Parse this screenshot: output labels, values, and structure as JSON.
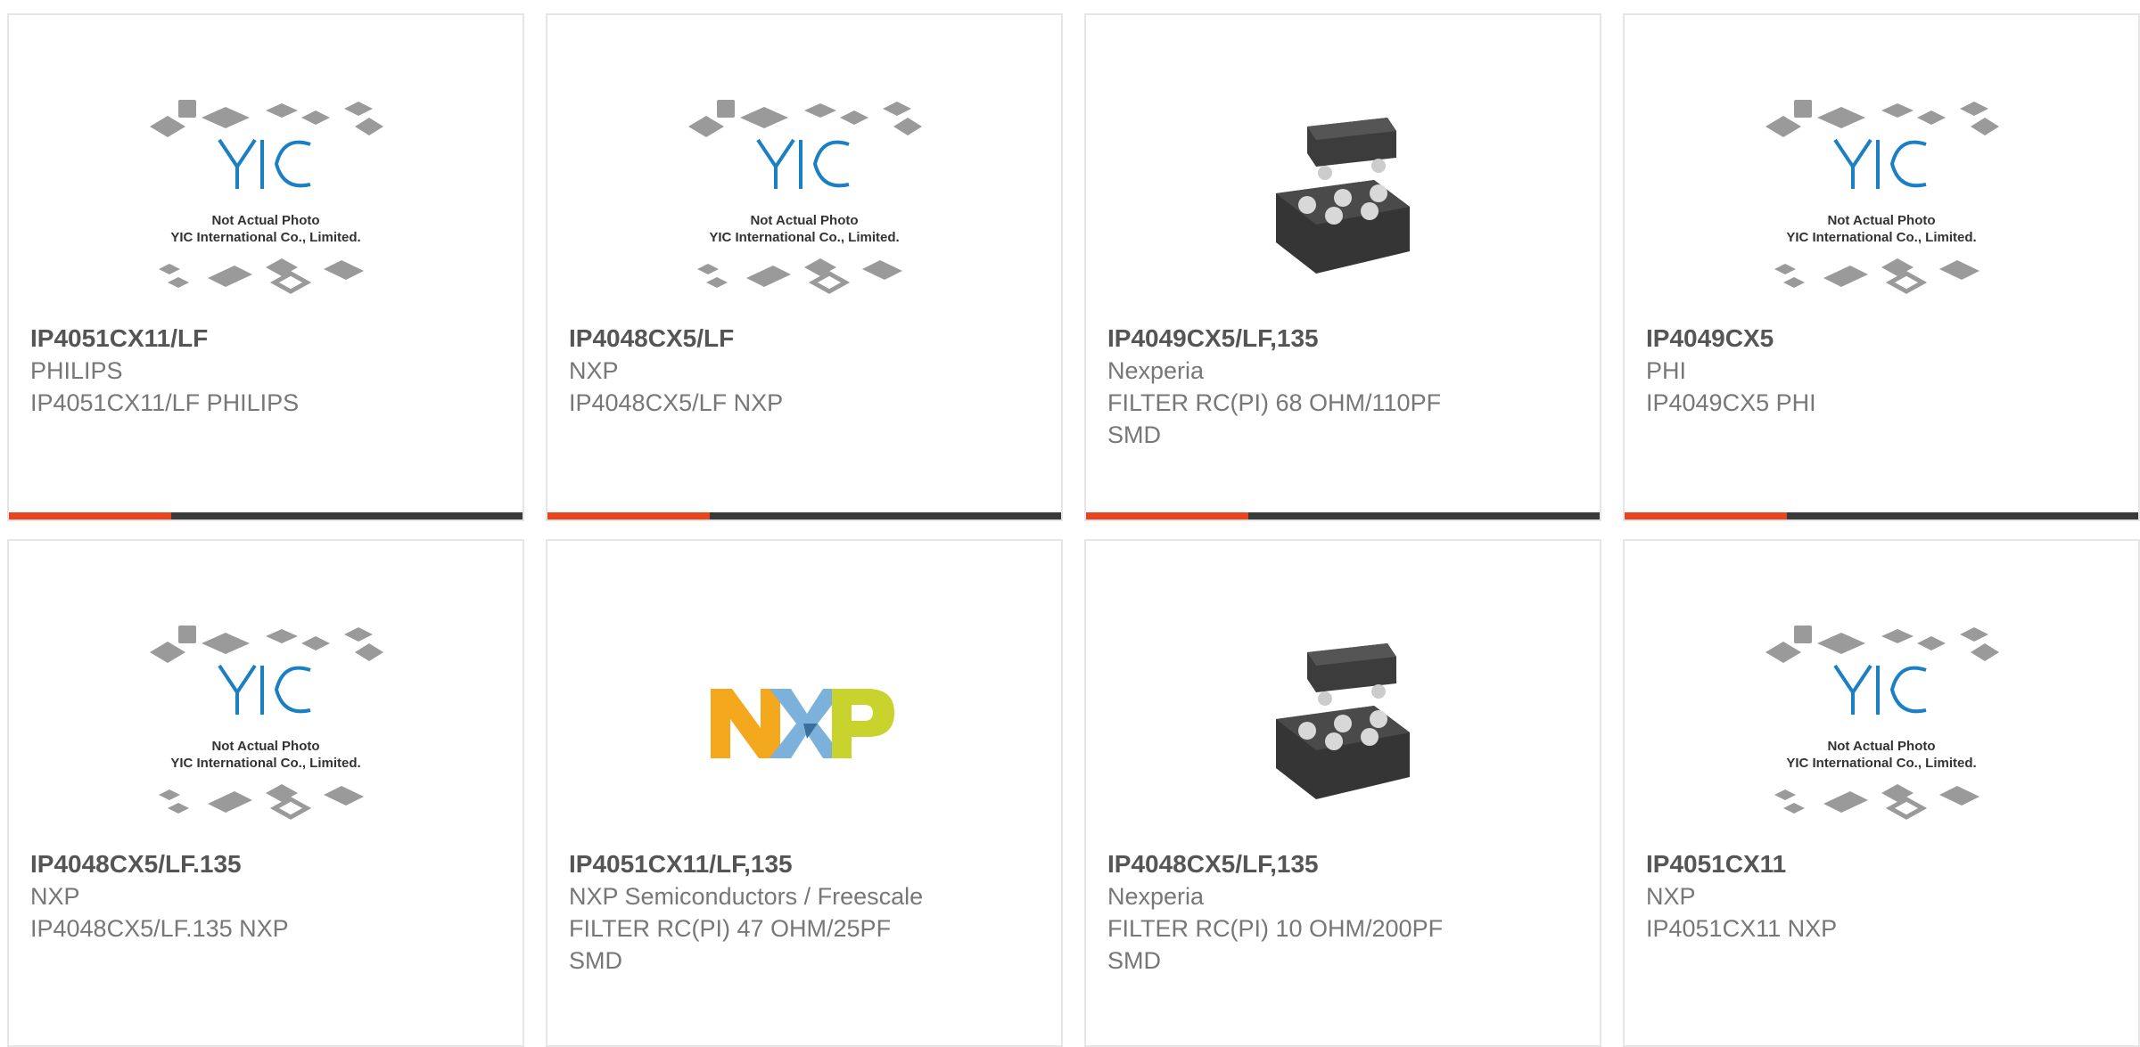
{
  "accent_color": "#e8451e",
  "dark_color": "#3a3a3a",
  "placeholder": {
    "line1": "Not Actual Photo",
    "line2": "YIC International Co., Limited.",
    "logo_text": "YIC"
  },
  "nxp_logo_text": "NXP",
  "products": [
    {
      "part": "IP4051CX11/LF",
      "manufacturer": "PHILIPS",
      "desc1": "IP4051CX11/LF PHILIPS",
      "desc2": "",
      "image": "placeholder-image"
    },
    {
      "part": "IP4048CX5/LF",
      "manufacturer": "NXP",
      "desc1": "IP4048CX5/LF NXP",
      "desc2": "",
      "image": "placeholder-image"
    },
    {
      "part": "IP4049CX5/LF,135",
      "manufacturer": "Nexperia",
      "desc1": "FILTER RC(PI) 68 OHM/110PF",
      "desc2": "SMD",
      "image": "chip-photo"
    },
    {
      "part": "IP4049CX5",
      "manufacturer": "PHI",
      "desc1": "IP4049CX5 PHI",
      "desc2": "",
      "image": "placeholder-image"
    },
    {
      "part": "IP4048CX5/LF.135",
      "manufacturer": "NXP",
      "desc1": "IP4048CX5/LF.135 NXP",
      "desc2": "",
      "image": "placeholder-image"
    },
    {
      "part": "IP4051CX11/LF,135",
      "manufacturer": "NXP Semiconductors / Freescale",
      "desc1": "FILTER RC(PI) 47 OHM/25PF",
      "desc2": "SMD",
      "image": "nxp-logo"
    },
    {
      "part": "IP4048CX5/LF,135",
      "manufacturer": "Nexperia",
      "desc1": "FILTER RC(PI) 10 OHM/200PF",
      "desc2": "SMD",
      "image": "chip-photo"
    },
    {
      "part": "IP4051CX11",
      "manufacturer": "NXP",
      "desc1": "IP4051CX11 NXP",
      "desc2": "",
      "image": "placeholder-image"
    }
  ]
}
